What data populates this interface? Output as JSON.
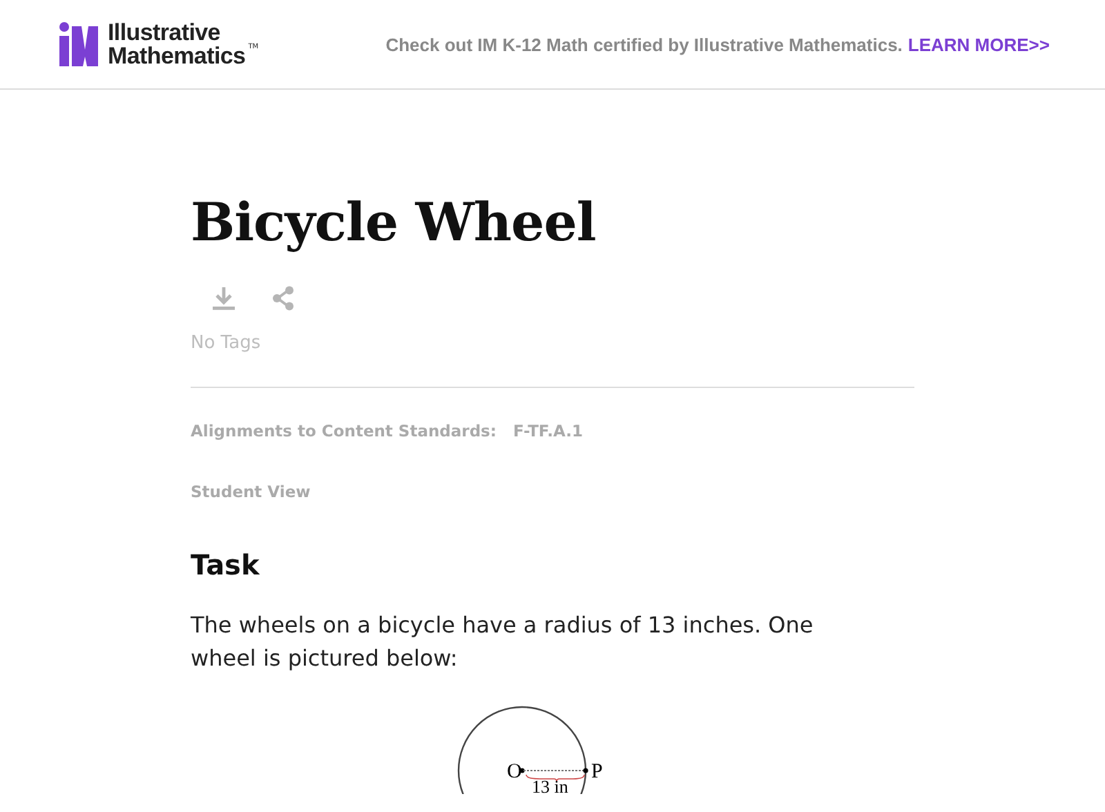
{
  "header": {
    "logo": {
      "line_1": "Illustrative",
      "line_2": "Mathematics",
      "trademark": "TM"
    },
    "promo": {
      "text": "Check out IM K-12 Math certified by Illustrative Mathematics.",
      "link": "LEARN MORE>>"
    }
  },
  "article": {
    "title": "Bicycle Wheel",
    "tags": "No Tags",
    "alignments": {
      "label": "Alignments to Content Standards:",
      "standard": "F-TF.A.1"
    },
    "view_link": "Student View",
    "section_heading": "Task",
    "paragraph": "The wheels on a bicycle have a radius of 13 inches. One wheel is pictured below:",
    "figure": {
      "center_label": "O",
      "point_label": "P",
      "radius_label": "13 in"
    }
  }
}
